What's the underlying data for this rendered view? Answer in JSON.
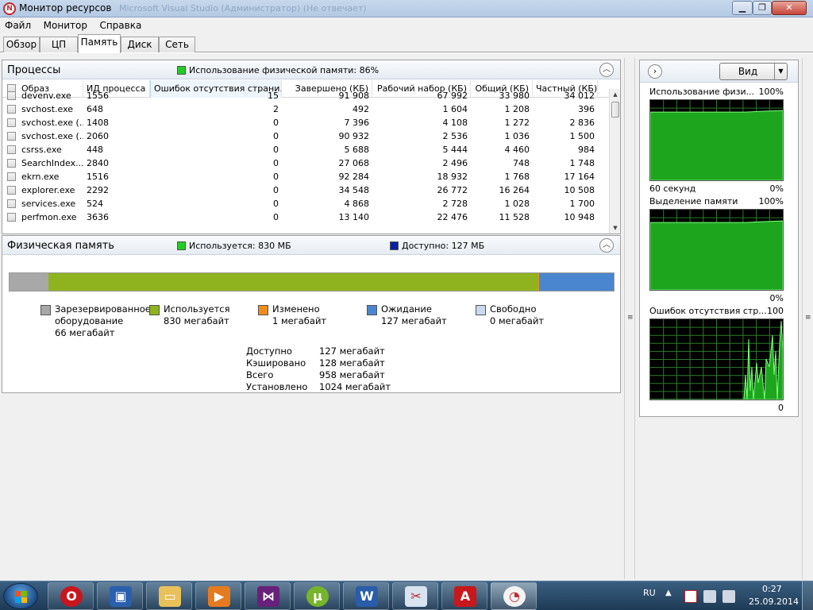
{
  "window": {
    "title": "Монитор ресурсов",
    "ghost_title": "Microsoft Visual Studio (Администратор) (Не отвечает)"
  },
  "menu": [
    "Файл",
    "Монитор",
    "Справка"
  ],
  "tabs": [
    "Обзор",
    "ЦП",
    "Память",
    "Диск",
    "Сеть"
  ],
  "active_tab": "Память",
  "processes": {
    "title": "Процессы",
    "legend": "Использование физической памяти: 86%",
    "legend_color": "#22cc22",
    "columns": [
      "Образ",
      "ИД процесса",
      "Ошибок отсутствия страни...",
      "Завершено (КБ)",
      "Рабочий набор (КБ)",
      "Общий (КБ)",
      "Частный (КБ)"
    ],
    "rows": [
      [
        "devenv.exe",
        "1556",
        "15",
        "91 908",
        "67 992",
        "33 980",
        "34 012"
      ],
      [
        "svchost.exe",
        "648",
        "2",
        "492",
        "1 604",
        "1 208",
        "396"
      ],
      [
        "svchost.exe (...",
        "1408",
        "0",
        "7 396",
        "4 108",
        "1 272",
        "2 836"
      ],
      [
        "svchost.exe (...",
        "2060",
        "0",
        "90 932",
        "2 536",
        "1 036",
        "1 500"
      ],
      [
        "csrss.exe",
        "448",
        "0",
        "5 688",
        "5 444",
        "4 460",
        "984"
      ],
      [
        "SearchIndex...",
        "2840",
        "0",
        "27 068",
        "2 496",
        "748",
        "1 748"
      ],
      [
        "ekrn.exe",
        "1516",
        "0",
        "92 284",
        "18 932",
        "1 768",
        "17 164"
      ],
      [
        "explorer.exe",
        "2292",
        "0",
        "34 548",
        "26 772",
        "16 264",
        "10 508"
      ],
      [
        "services.exe",
        "524",
        "0",
        "4 868",
        "2 728",
        "1 028",
        "1 700"
      ],
      [
        "perfmon.exe",
        "3636",
        "0",
        "13 140",
        "22 476",
        "11 528",
        "10 948"
      ]
    ]
  },
  "physical": {
    "title": "Физическая память",
    "legend_used": "Используется: 830 МБ",
    "legend_avail": "Доступно: 127 МБ",
    "bar": {
      "reserved_mb": 66,
      "used_mb": 830,
      "modified_mb": 1,
      "standby_mb": 127,
      "free_mb": 0,
      "installed_mb": 1024
    },
    "legend_items": [
      {
        "label": "Зарезервированное",
        "label2": "оборудование",
        "value": "66 мегабайт",
        "color": "#a8a8a8"
      },
      {
        "label": "Используется",
        "label2": "",
        "value": "830 мегабайт",
        "color": "#8fb31f"
      },
      {
        "label": "Изменено",
        "label2": "",
        "value": "1 мегабайт",
        "color": "#f08c1a"
      },
      {
        "label": "Ожидание",
        "label2": "",
        "value": "127 мегабайт",
        "color": "#4a86cf"
      },
      {
        "label": "Свободно",
        "label2": "",
        "value": "0 мегабайт",
        "color": "#c9d9ee"
      }
    ],
    "summary": [
      {
        "label": "Доступно",
        "value": "127 мегабайт"
      },
      {
        "label": "Кэшировано",
        "value": "128 мегабайт"
      },
      {
        "label": "Всего",
        "value": "958 мегабайт"
      },
      {
        "label": "Установлено",
        "value": "1024 мегабайт"
      }
    ]
  },
  "side_panel": {
    "view_button": "Вид",
    "graphs": [
      {
        "title": "Использование физи...",
        "max": "100%",
        "left_bottom": "60 секунд",
        "min": "0%",
        "level_pct": 86
      },
      {
        "title": "Выделение памяти",
        "max": "100%",
        "left_bottom": "",
        "min": "0%",
        "level_pct": 85
      },
      {
        "title": "Ошибок отсутствия стр...",
        "max": "100",
        "left_bottom": "",
        "min": "0"
      }
    ]
  },
  "taskbar": {
    "language": "RU",
    "time": "0:27",
    "date": "25.09.2014",
    "apps": [
      "opera",
      "save",
      "explorer",
      "media",
      "visual-studio",
      "utorrent",
      "word",
      "snipping-tool",
      "acrobat",
      "resource-monitor"
    ]
  }
}
